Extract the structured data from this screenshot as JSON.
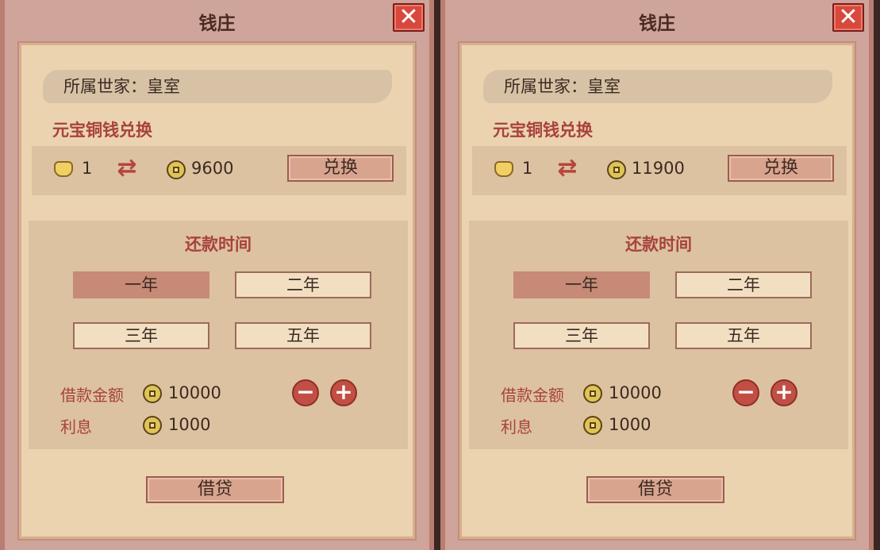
{
  "panels": [
    {
      "title": "钱庄",
      "close_icon": "✕",
      "family_label": "所属世家：皇室",
      "exchange": {
        "title": "元宝铜钱兑换",
        "ingot_amount": "1",
        "coin_amount": "9600",
        "swap_icon": "⇄",
        "button": "兑换"
      },
      "repayment": {
        "title": "还款时间",
        "options": [
          "一年",
          "二年",
          "三年",
          "五年"
        ],
        "selected": "一年"
      },
      "loan": {
        "amount_label": "借款金额",
        "amount": "10000",
        "interest_label": "利息",
        "interest": "1000",
        "minus": "−",
        "plus": "+"
      },
      "button": "借贷"
    },
    {
      "title": "钱庄",
      "close_icon": "✕",
      "family_label": "所属世家：皇室",
      "exchange": {
        "title": "元宝铜钱兑换",
        "ingot_amount": "1",
        "coin_amount": "11900",
        "swap_icon": "⇄",
        "button": "兑换"
      },
      "repayment": {
        "title": "还款时间",
        "options": [
          "一年",
          "二年",
          "三年",
          "五年"
        ],
        "selected": "一年"
      },
      "loan": {
        "amount_label": "借款金额",
        "amount": "10000",
        "interest_label": "利息",
        "interest": "1000",
        "minus": "−",
        "plus": "+"
      },
      "button": "借贷"
    }
  ],
  "colors": {
    "accent_red": "#a8423c",
    "button_fill": "#d9a48e",
    "selected_fill": "#c68a76",
    "close_red": "#d9483c"
  }
}
